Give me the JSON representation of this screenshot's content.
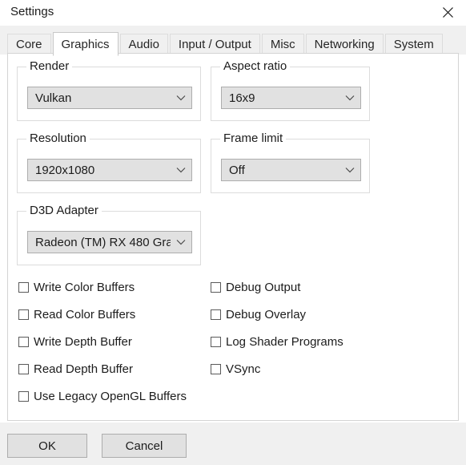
{
  "window": {
    "title": "Settings",
    "close_icon": "close-icon"
  },
  "tabs": [
    {
      "label": "Core",
      "selected": false
    },
    {
      "label": "Graphics",
      "selected": true
    },
    {
      "label": "Audio",
      "selected": false
    },
    {
      "label": "Input / Output",
      "selected": false
    },
    {
      "label": "Misc",
      "selected": false
    },
    {
      "label": "Networking",
      "selected": false
    },
    {
      "label": "System",
      "selected": false
    }
  ],
  "groups": {
    "render": {
      "title": "Render",
      "combo_value": "Vulkan",
      "combo_icon": "chevron-down-icon"
    },
    "aspect_ratio": {
      "title": "Aspect ratio",
      "combo_value": "16x9",
      "combo_icon": "chevron-down-icon"
    },
    "resolution": {
      "title": "Resolution",
      "combo_value": "1920x1080",
      "combo_icon": "chevron-down-icon"
    },
    "frame_limit": {
      "title": "Frame limit",
      "combo_value": "Off",
      "combo_icon": "chevron-down-icon"
    },
    "d3d_adapter": {
      "title": "D3D Adapter",
      "combo_value": "Radeon (TM) RX 480 Gra",
      "combo_icon": "chevron-down-icon"
    }
  },
  "checkboxes_left": [
    {
      "label": "Write Color Buffers",
      "checked": false
    },
    {
      "label": "Read Color Buffers",
      "checked": false
    },
    {
      "label": "Write Depth Buffer",
      "checked": false
    },
    {
      "label": "Read Depth Buffer",
      "checked": false
    },
    {
      "label": "Use Legacy OpenGL Buffers",
      "checked": false
    }
  ],
  "checkboxes_right": [
    {
      "label": "Debug Output",
      "checked": false
    },
    {
      "label": "Debug Overlay",
      "checked": false
    },
    {
      "label": "Log Shader Programs",
      "checked": false
    },
    {
      "label": "VSync",
      "checked": false
    }
  ],
  "footer": {
    "ok_label": "OK",
    "cancel_label": "Cancel"
  },
  "colors": {
    "dialog_background": "#f0f0f0",
    "panel_background": "#ffffff",
    "control_face": "#e1e1e1",
    "control_border": "#adadad",
    "group_border": "#dcdcdc",
    "text": "#1c1c1c"
  }
}
